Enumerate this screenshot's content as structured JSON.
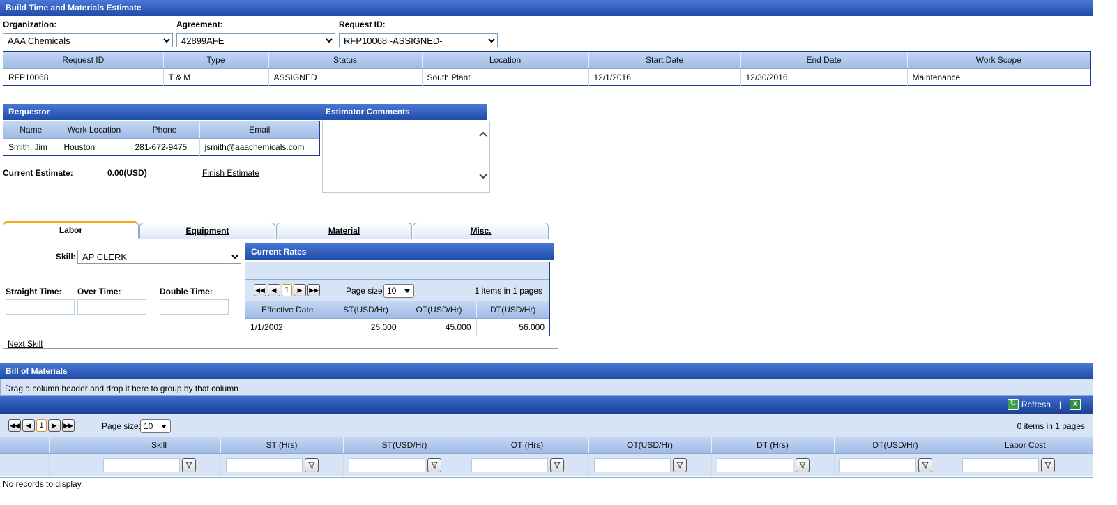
{
  "page": {
    "title": "Build Time and Materials Estimate"
  },
  "filters": {
    "organization_label": "Organization:",
    "organization_value": "AAA Chemicals",
    "agreement_label": "Agreement:",
    "agreement_value": "42899AFE",
    "request_label": "Request ID:",
    "request_value": "RFP10068 -ASSIGNED-"
  },
  "request_table": {
    "headers": [
      "Request ID",
      "Type",
      "Status",
      "Location",
      "Start Date",
      "End Date",
      "Work Scope"
    ],
    "row": [
      "RFP10068",
      "T & M",
      "ASSIGNED",
      "South Plant",
      "12/1/2016",
      "12/30/2016",
      "Maintenance"
    ]
  },
  "requestor": {
    "title": "Requestor",
    "headers": [
      "Name",
      "Work Location",
      "Phone",
      "Email"
    ],
    "row": [
      "Smith, Jim",
      "Houston",
      "281-672-9475",
      "jsmith@aaachemicals.com"
    ]
  },
  "estimator": {
    "title": "Estimator Comments"
  },
  "estimate": {
    "label": "Current Estimate:",
    "value": "0.00(USD)",
    "finish_link": "Finish Estimate"
  },
  "tabs": [
    "Labor",
    "Equipment",
    "Material",
    "Misc."
  ],
  "labor": {
    "skill_label": "Skill:",
    "skill_value": "AP CLERK",
    "straight_label": "Straight Time:",
    "over_label": "Over Time:",
    "double_label": "Double Time:",
    "next_skill": "Next Skill"
  },
  "rates": {
    "title": "Current Rates",
    "page_num": "1",
    "page_size_label": "Page size:",
    "page_size": "10",
    "info": "1 items in 1 pages",
    "headers": [
      "Effective Date",
      "ST(USD/Hr)",
      "OT(USD/Hr)",
      "DT(USD/Hr)"
    ],
    "row": [
      "1/1/2002",
      "25.000",
      "45.000",
      "56.000"
    ]
  },
  "bom": {
    "title": "Bill of Materials",
    "group_hint": "Drag a column header and drop it here to group by that column",
    "refresh": "Refresh",
    "page_num": "1",
    "page_size_label": "Page size:",
    "page_size": "10",
    "info": "0 items in 1 pages",
    "headers": [
      "Skill",
      "ST (Hrs)",
      "ST(USD/Hr)",
      "OT (Hrs)",
      "OT(USD/Hr)",
      "DT (Hrs)",
      "DT(USD/Hr)",
      "Labor Cost"
    ],
    "empty": "No records to display."
  },
  "colors": {
    "header_blue": "#1f4ca8",
    "grid_header": "#9fbbe6",
    "active_tab": "#f5a623"
  }
}
